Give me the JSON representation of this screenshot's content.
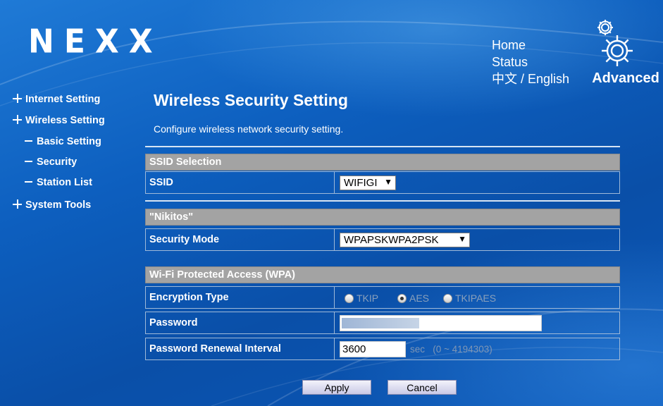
{
  "brand": {
    "logo": "NEXX"
  },
  "top_nav": {
    "home": "Home",
    "status": "Status",
    "lang_zh": "中文",
    "lang_sep": " / ",
    "lang_en": "English",
    "advanced": "Advanced"
  },
  "sidebar": {
    "items": [
      {
        "label": "Internet Setting",
        "marker": "plus"
      },
      {
        "label": "Wireless Setting",
        "marker": "plus"
      },
      {
        "label": "Basic Setting",
        "marker": "dash"
      },
      {
        "label": "Security",
        "marker": "dash"
      },
      {
        "label": "Station List",
        "marker": "dash"
      },
      {
        "label": "System Tools",
        "marker": "plus"
      }
    ]
  },
  "main": {
    "title": "Wireless Security Setting",
    "description": "Configure wireless network security setting.",
    "ssid_section": {
      "header": "SSID Selection",
      "ssid_label": "SSID",
      "ssid_value": "WIFIGI"
    },
    "network_section": {
      "header": "\"Nikitos\"",
      "security_mode_label": "Security Mode",
      "security_mode_value": "WPAPSKWPA2PSK"
    },
    "wpa_section": {
      "header": "Wi-Fi Protected Access (WPA)",
      "encryption_label": "Encryption Type",
      "encryption_options": [
        "TKIP",
        "AES",
        "TKIPAES"
      ],
      "encryption_selected": "AES",
      "password_label": "Password",
      "renewal_label": "Password Renewal Interval",
      "renewal_value": "3600",
      "renewal_unit": "sec   (0 ~ 4194303)"
    },
    "buttons": {
      "apply": "Apply",
      "cancel": "Cancel"
    }
  },
  "colors": {
    "background": "#0d5fbf",
    "section_header": "#a3a3a3",
    "row_border": "#9fb9d8",
    "button_gradient": "#c9c9e6"
  }
}
